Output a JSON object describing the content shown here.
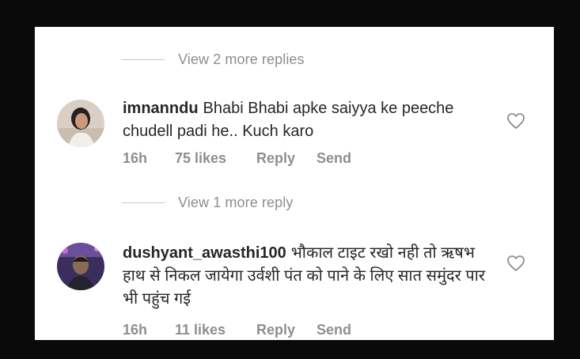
{
  "comments": [
    {
      "view_more": "View 2 more replies",
      "username": "imnanndu",
      "text": "Bhabi Bhabi apke saiyya ke peeche chudell padi he.. Kuch karo",
      "time": "16h",
      "likes": "75 likes",
      "reply_label": "Reply",
      "send_label": "Send",
      "avatar_icon": "profile-photo-woman",
      "like_icon": "heart-outline-icon"
    },
    {
      "view_more": "View 1 more reply",
      "username": "dushyant_awasthi100",
      "text": "भौकाल टाइट रखो नही तो ऋषभ हाथ से निकल जायेगा उर्वशी पंत को पाने के लिए सात समुंदर पार भी पहुंच गई",
      "time": "16h",
      "likes": "11 likes",
      "reply_label": "Reply",
      "send_label": "Send",
      "avatar_icon": "profile-photo-man",
      "like_icon": "heart-outline-icon"
    }
  ],
  "colors": {
    "background": "#0a0a0a",
    "panel": "#ffffff",
    "text": "#262626",
    "muted": "#8e8e8e"
  }
}
